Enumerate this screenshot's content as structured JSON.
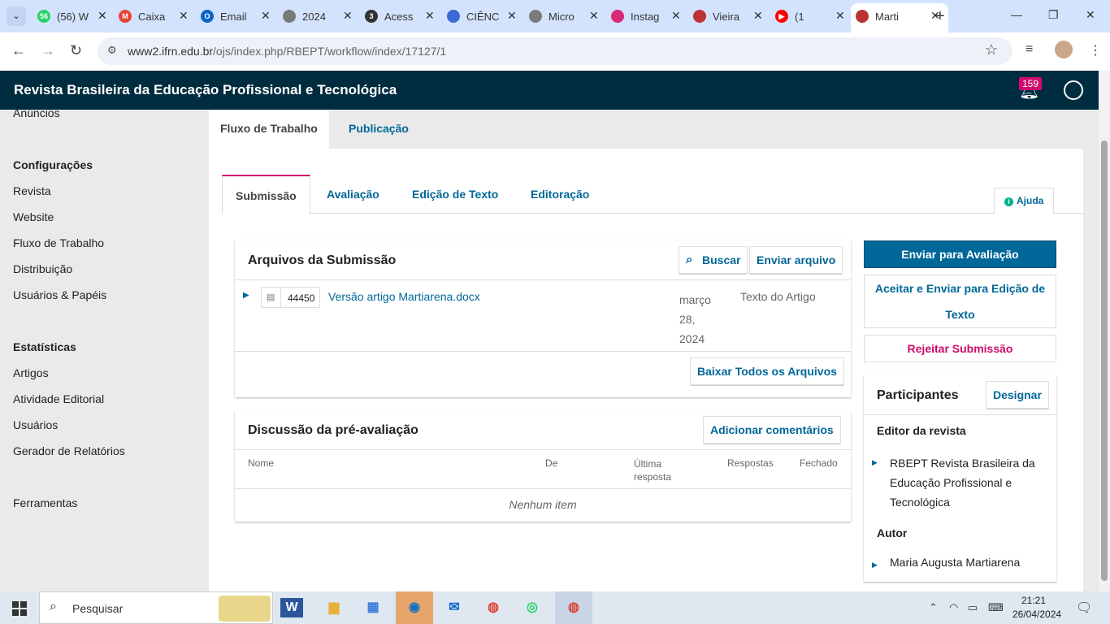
{
  "browser": {
    "tabs": [
      {
        "title": "(56) W",
        "icon": "whatsapp-icon",
        "fav_text": "56",
        "color": "#25d366"
      },
      {
        "title": "Caixa",
        "icon": "gmail-icon",
        "fav_text": "M",
        "color": "#ea4335"
      },
      {
        "title": "Email",
        "icon": "outlook-icon",
        "fav_text": "O",
        "color": "#0a64c8"
      },
      {
        "title": "2024",
        "icon": "globe-icon",
        "fav_text": "",
        "color": "#7a7a7a"
      },
      {
        "title": "Acess",
        "icon": "number-icon",
        "fav_text": "3",
        "color": "#333333"
      },
      {
        "title": "CIÊNC",
        "icon": "profile-card-icon",
        "fav_text": "",
        "color": "#3a6ad4"
      },
      {
        "title": "Micro",
        "icon": "globe-icon",
        "fav_text": "",
        "color": "#7a7a7a"
      },
      {
        "title": "Instag",
        "icon": "instagram-icon",
        "fav_text": "",
        "color": "#d62976"
      },
      {
        "title": "Vieira",
        "icon": "ojs-icon",
        "fav_text": "",
        "color": "#b33"
      },
      {
        "title": "(1",
        "icon": "youtube-icon",
        "fav_text": "▶",
        "color": "#ff0000"
      },
      {
        "title": "Marti",
        "icon": "ojs-icon",
        "fav_text": "",
        "color": "#b33"
      }
    ],
    "url_host": "www2.ifrn.edu.br",
    "url_path": "/ojs/index.php/RBEPT/workflow/index/17127/1"
  },
  "header": {
    "title": "Revista Brasileira da Educação Profissional e Tecnológica",
    "notifications": "159"
  },
  "sidebar": {
    "top_partial": "Anúncios",
    "groups": [
      {
        "heading": "Configurações",
        "items": [
          "Revista",
          "Website",
          "Fluxo de Trabalho",
          "Distribuição",
          "Usuários & Papéis"
        ]
      },
      {
        "heading": "Estatísticas",
        "items": [
          "Artigos",
          "Atividade Editorial",
          "Usuários",
          "Gerador de Relatórios"
        ]
      }
    ],
    "tools": "Ferramentas"
  },
  "workflow_tabs": [
    "Fluxo de Trabalho",
    "Publicação"
  ],
  "stage_tabs": [
    "Submissão",
    "Avaliação",
    "Edição de Texto",
    "Editoração"
  ],
  "help": "Ajuda",
  "files": {
    "title": "Arquivos da Submissão",
    "search": "Buscar",
    "upload": "Enviar arquivo",
    "file_id": "44450",
    "file_name": "Versão artigo Martiarena.docx",
    "date_lines": [
      "março",
      "28,",
      "2024"
    ],
    "type": "Texto do Artigo",
    "download_all": "Baixar Todos os Arquivos"
  },
  "discussion": {
    "title": "Discussão da pré-avaliação",
    "add": "Adicionar comentários",
    "columns": {
      "name": "Nome",
      "from": "De",
      "last_1": "Última",
      "last_2": "resposta",
      "replies": "Respostas",
      "closed": "Fechado"
    },
    "empty": "Nenhum item"
  },
  "actions": {
    "send_review": "Enviar para Avaliação",
    "accept_1": "Aceitar e Enviar para Edição de",
    "accept_2": "Texto",
    "reject": "Rejeitar Submissão"
  },
  "participants": {
    "title": "Participantes",
    "assign": "Designar",
    "editor_role": "Editor da revista",
    "editor_1": "RBEPT Revista Brasileira da",
    "editor_2": "Educação Profissional e",
    "editor_3": "Tecnológica",
    "author_role": "Autor",
    "author": "Maria Augusta Martiarena"
  },
  "taskbar": {
    "search": "Pesquisar",
    "time": "21:21",
    "date": "26/04/2024"
  }
}
